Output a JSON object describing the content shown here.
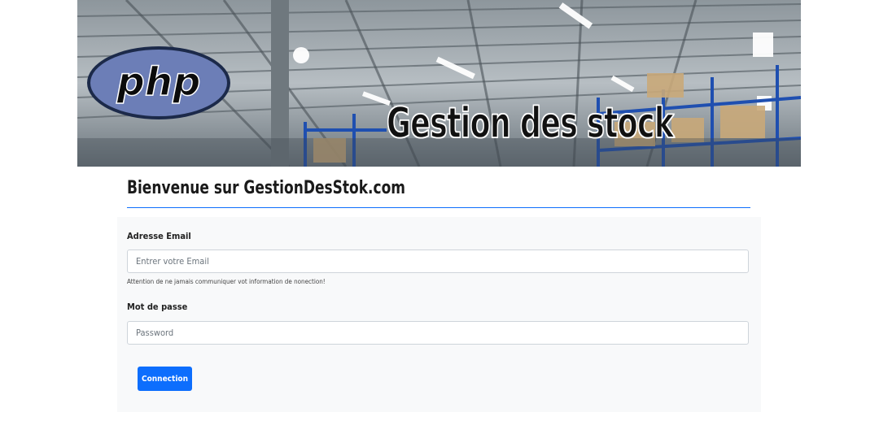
{
  "banner": {
    "logo_text": "php",
    "title": "Gestion des stock"
  },
  "welcome": {
    "heading": "Bienvenue sur GestionDesStok.com"
  },
  "form": {
    "email_label": "Adresse Email",
    "email_placeholder": "Entrer votre Email",
    "email_value": "",
    "email_help": "Attention de ne jamais communiquer vot information de nonection!",
    "password_label": "Mot de passe",
    "password_placeholder": "Password",
    "password_value": "",
    "submit_label": "Connection"
  },
  "colors": {
    "accent": "#0d6efd",
    "panel_background": "#f8f9fa",
    "php_logo_fill": "#6c7eb7"
  },
  "icons": [
    "php-logo"
  ]
}
